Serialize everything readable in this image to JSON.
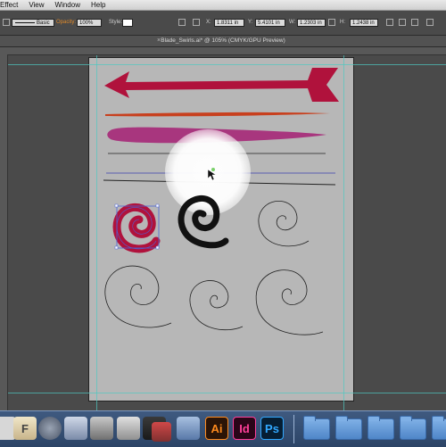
{
  "menu": {
    "items": [
      "Effect",
      "View",
      "Window",
      "Help"
    ]
  },
  "control_bar": {
    "stroke_label": "Basic",
    "opacity_label": "Opacity:",
    "opacity_value": "100%",
    "style_label": "Style:",
    "x_value": "1.8311 in",
    "y_value": "5.4101 in",
    "w_value": "1.2303 in",
    "h_value": "1.2438 in"
  },
  "document": {
    "tab_title": "Blade_Swirls.ai* @ 105% (CMYK/GPU Preview)"
  },
  "artwork": {
    "arrow_color": "#b0123c",
    "brush_orange": "#c8401e",
    "brush_magenta": "#a8367e",
    "line_blue": "#3a3fae",
    "spiral_red": "#b0123c",
    "selection_color": "#4b64d8"
  },
  "dock": {
    "apps": [
      {
        "name": "finder-icon",
        "label": "F"
      },
      {
        "name": "launchpad-icon",
        "label": ""
      },
      {
        "name": "safari-icon",
        "label": ""
      },
      {
        "name": "mail-icon",
        "label": ""
      },
      {
        "name": "photobooth-icon",
        "label": ""
      },
      {
        "name": "preview-icon",
        "label": ""
      },
      {
        "name": "photos-icon",
        "label": ""
      },
      {
        "name": "messages-icon",
        "label": ""
      },
      {
        "name": "system-preferences-icon",
        "label": ""
      }
    ],
    "ai_label": "Ai",
    "id_label": "Id",
    "ps_label": "Ps"
  }
}
